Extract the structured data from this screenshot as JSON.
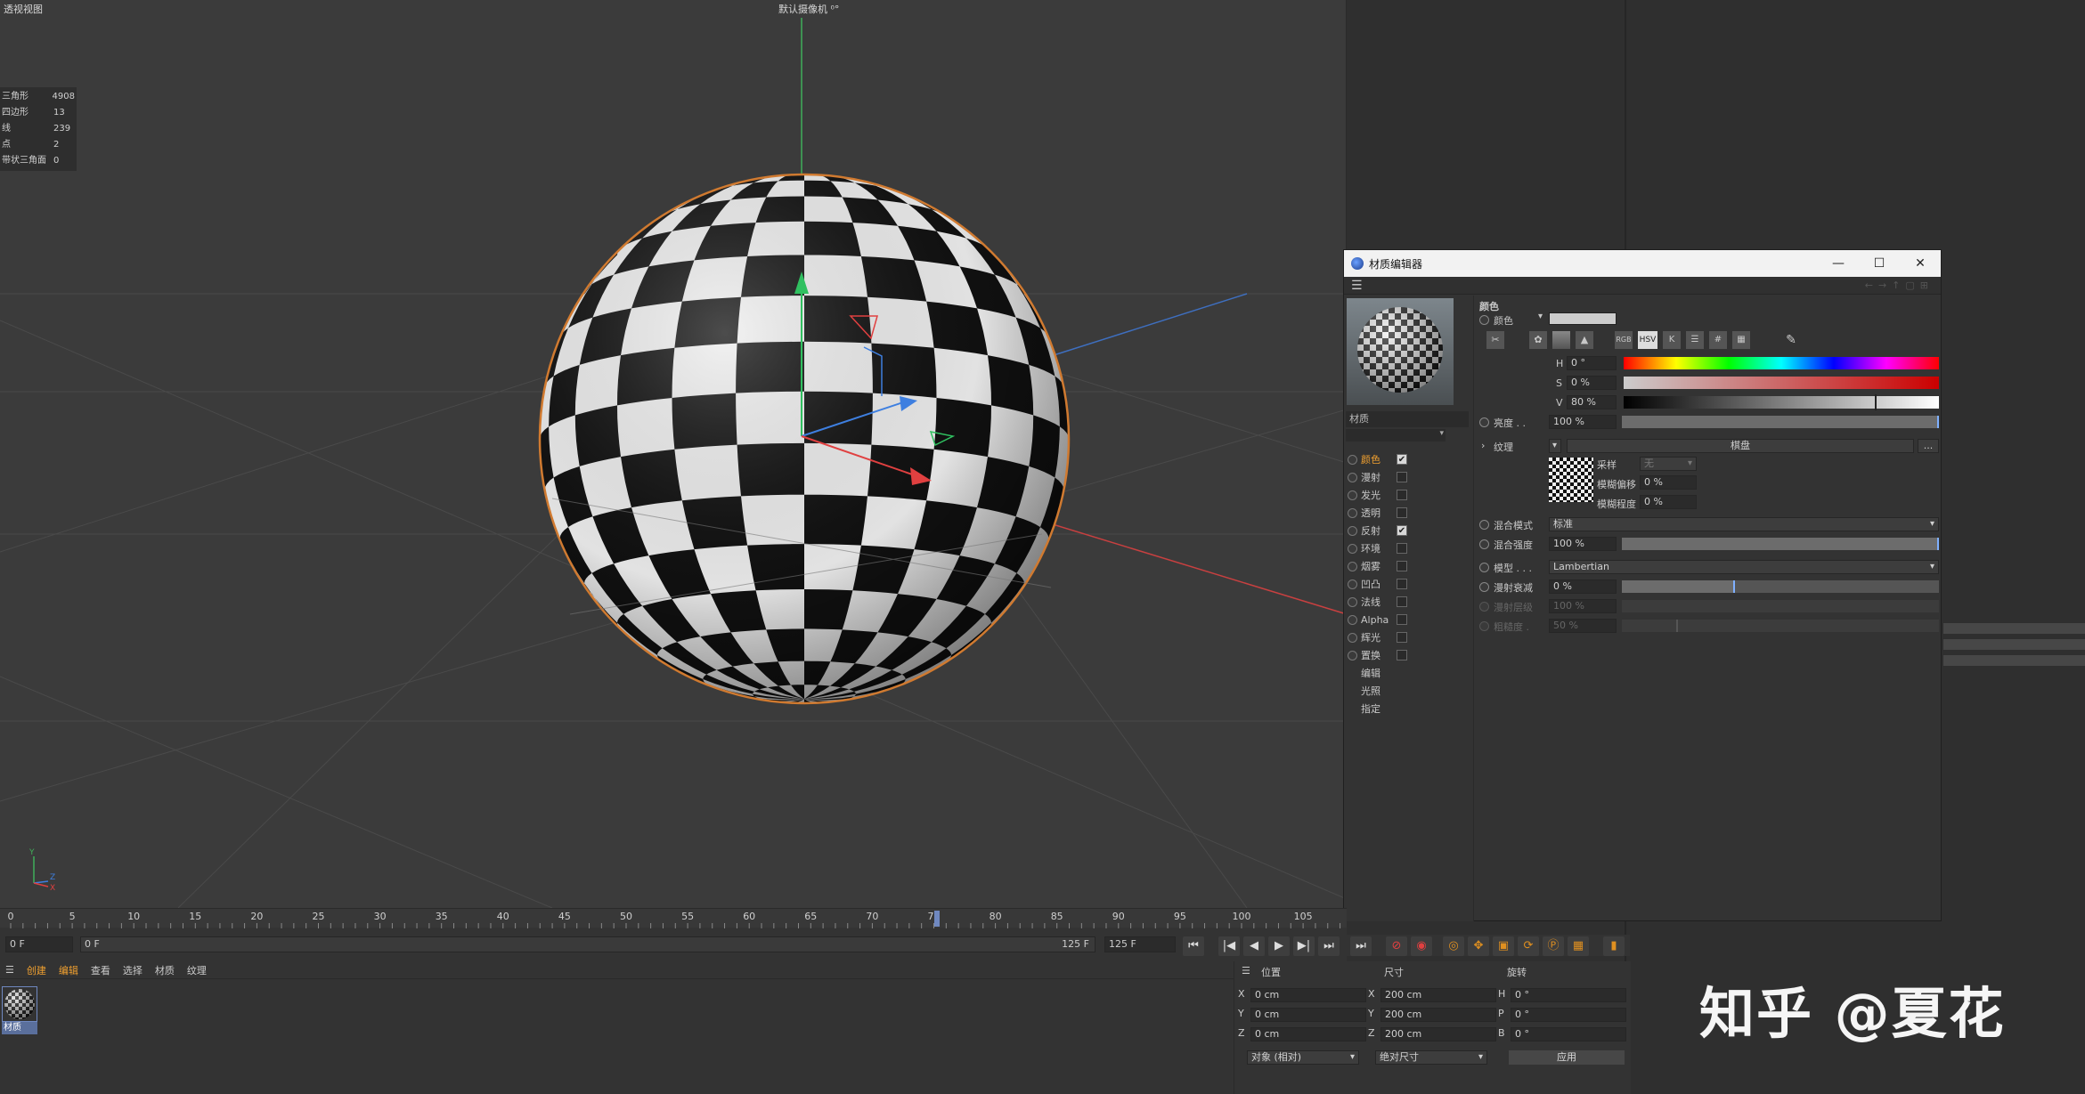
{
  "viewport": {
    "title": "透视视图",
    "camera_label": "默认摄像机 ⁰°",
    "stats": [
      {
        "label": "三角形",
        "value": "4908"
      },
      {
        "label": "四边形",
        "value": "13"
      },
      {
        "label": "线",
        "value": "239"
      },
      {
        "label": "点",
        "value": "2"
      },
      {
        "label": "带状三角面",
        "value": "0"
      }
    ],
    "axis_y": "Y",
    "axis_z": "Z",
    "axis_x": "X"
  },
  "material_editor": {
    "window_title": "材质编辑器",
    "minimize": "—",
    "maximize": "☐",
    "close": "✕",
    "material_name": "材质",
    "channels": [
      {
        "label": "颜色",
        "checked": true,
        "active": true
      },
      {
        "label": "漫射",
        "checked": false
      },
      {
        "label": "发光",
        "checked": false
      },
      {
        "label": "透明",
        "checked": false
      },
      {
        "label": "反射",
        "checked": true
      },
      {
        "label": "环境",
        "checked": false
      },
      {
        "label": "烟雾",
        "checked": false
      },
      {
        "label": "凹凸",
        "checked": false
      },
      {
        "label": "法线",
        "checked": false
      },
      {
        "label": "Alpha",
        "checked": false
      },
      {
        "label": "辉光",
        "checked": false
      },
      {
        "label": "置换",
        "checked": false
      }
    ],
    "extra_items": [
      "编辑",
      "光照",
      "指定"
    ],
    "section_title": "颜色",
    "color_label": "颜色",
    "hsv": {
      "h_label": "H",
      "h": "0 °",
      "s_label": "S",
      "s": "0 %",
      "v_label": "V",
      "v": "80 %"
    },
    "brightness_label": "亮度 . .",
    "brightness": "100 %",
    "texture_label": "纹理",
    "texture_name": "棋盘",
    "texture_more": "...",
    "sampling_label": "采样",
    "sampling_value": "无",
    "blur_offset_label": "模糊偏移",
    "blur_offset": "0 %",
    "blur_scale_label": "模糊程度",
    "blur_scale": "0 %",
    "blend_mode_label": "混合模式",
    "blend_mode": "标准",
    "blend_strength_label": "混合强度",
    "blend_strength": "100 %",
    "model_label": "模型 . . .",
    "model": "Lambertian",
    "diffuse_falloff_label": "漫射衰减",
    "diffuse_falloff": "0 %",
    "diffuse_level_label": "漫射层级",
    "diffuse_level": "100 %",
    "roughness_label": "粗糙度 .",
    "roughness": "50 %",
    "hsv_icon_label": "HSV"
  },
  "timeline": {
    "ticks": [
      "0",
      "5",
      "10",
      "15",
      "20",
      "25",
      "30",
      "35",
      "40",
      "45",
      "50",
      "55",
      "60",
      "65",
      "70",
      "75",
      "80",
      "85",
      "90",
      "95",
      "100",
      "105"
    ],
    "current_frame": "0 F",
    "range_start": "0 F",
    "range_end": "125 F",
    "max_frame": "125 F"
  },
  "material_manager": {
    "menu": [
      "创建",
      "编辑",
      "查看",
      "选择",
      "材质",
      "纹理"
    ],
    "material_label": "材质"
  },
  "coordinates": {
    "headers": [
      "位置",
      "尺寸",
      "旋转"
    ],
    "rows": [
      {
        "axis": "X",
        "pos": "0 cm",
        "size_axis": "X",
        "size": "200 cm",
        "rot_axis": "H",
        "rot": "0 °"
      },
      {
        "axis": "Y",
        "pos": "0 cm",
        "size_axis": "Y",
        "size": "200 cm",
        "rot_axis": "P",
        "rot": "0 °"
      },
      {
        "axis": "Z",
        "pos": "0 cm",
        "size_axis": "Z",
        "size": "200 cm",
        "rot_axis": "B",
        "rot": "0 °"
      }
    ],
    "mode": "对象 (相对)",
    "size_mode": "绝对尺寸",
    "apply": "应用"
  },
  "watermark": "知乎 @夏花",
  "colors": {
    "accent_orange": "#f0a030",
    "selection_blue": "#6f88c0",
    "viewport_bg": "#3b3b3b"
  }
}
